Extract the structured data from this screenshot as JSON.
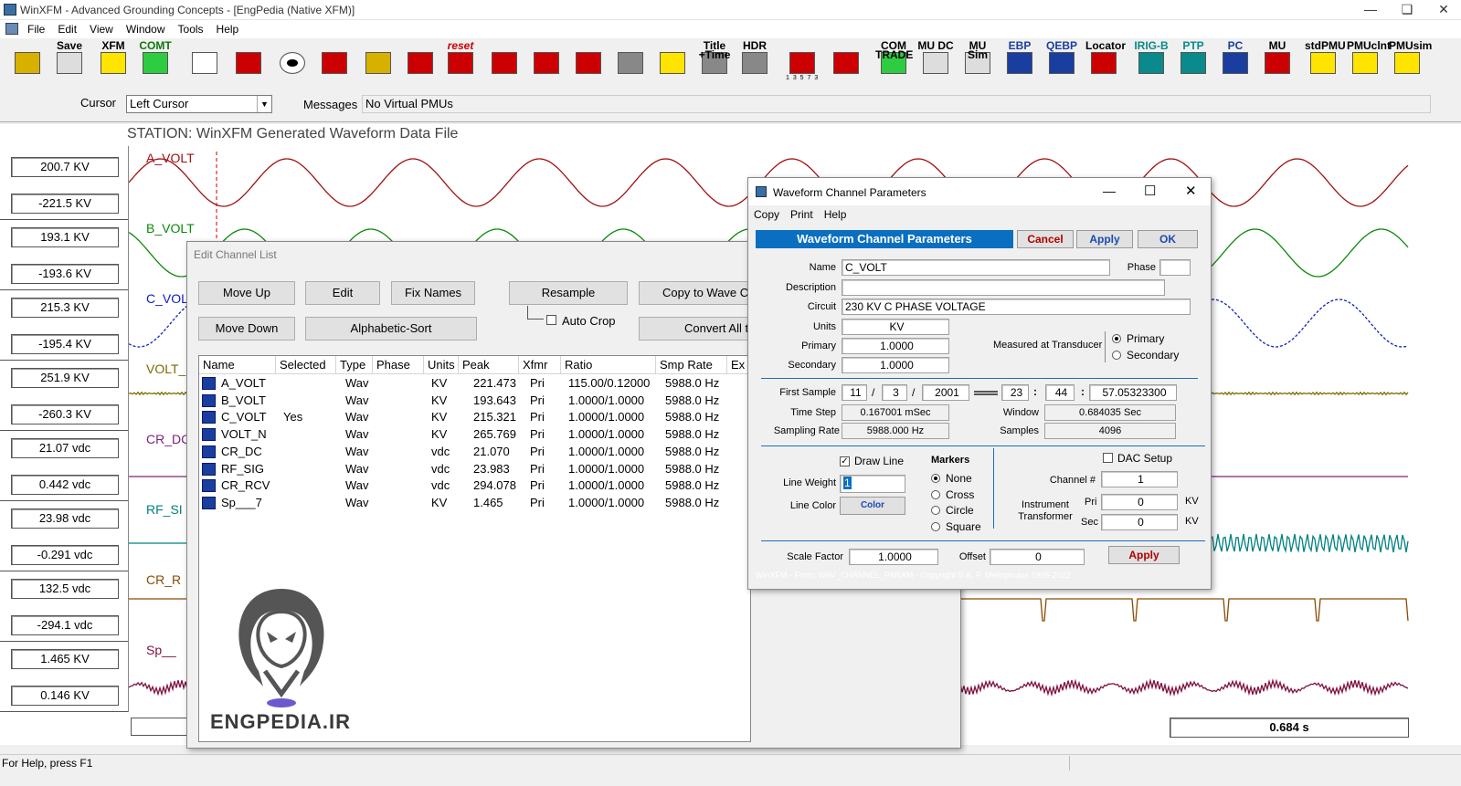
{
  "app": {
    "title": "WinXFM - Advanced Grounding Concepts - [EngPedia (Native XFM)]"
  },
  "menu": [
    "File",
    "Edit",
    "View",
    "Window",
    "Tools",
    "Help"
  ],
  "toolbar": {
    "labels": {
      "save": "Save",
      "xfm": "XFM",
      "comt": "COMT",
      "reset": "reset",
      "title_time": "Title +Time",
      "hdr": "HDR",
      "com_trade": "COM TRADE",
      "mu_dc": "MU DC",
      "mu_sim": "MU Sim",
      "ebp": "EBP",
      "qebp": "QEBP",
      "locator": "Locator",
      "irig_b": "IRIG-B",
      "ptp": "PTP",
      "pc": "PC",
      "mu": "MU",
      "stdpmu": "stdPMU",
      "pmuclnt": "PMUclnt",
      "pmusim": "PMUsim"
    },
    "scale_digits": "1 3 5 7 3"
  },
  "cursorbar": {
    "cursor_label": "Cursor",
    "cursor_value": "Left Cursor",
    "messages_label": "Messages",
    "messages_value": "No Virtual PMUs"
  },
  "plot": {
    "station": "STATION: WinXFM Generated Waveform Data File",
    "channels": [
      {
        "name": "A_VOLT",
        "max": "200.7 KV",
        "min": "-221.5 KV",
        "color": "#a01010"
      },
      {
        "name": "B_VOLT",
        "max": "193.1 KV",
        "min": "-193.6 KV",
        "color": "#0a8a0a"
      },
      {
        "name": "C_VOL",
        "max": "215.3 KV",
        "min": "-195.4 KV",
        "color": "#1020c0"
      },
      {
        "name": "VOLT_",
        "max": "251.9 KV",
        "min": "-260.3 KV",
        "color": "#7a6a00"
      },
      {
        "name": "CR_DC",
        "max": "21.07 vdc",
        "min": "0.442 vdc",
        "color": "#802080"
      },
      {
        "name": "RF_SI",
        "max": "23.98 vdc",
        "min": "-0.291 vdc",
        "color": "#008080"
      },
      {
        "name": "CR_R",
        "max": "132.5 vdc",
        "min": "-294.1 vdc",
        "color": "#8a4a00"
      },
      {
        "name": "Sp__",
        "max": "1.465 KV",
        "min": "0.146 KV",
        "color": "#801040"
      }
    ],
    "time_readout": "0.684 s"
  },
  "status": {
    "text": "For Help, press F1"
  },
  "edit_channel_list": {
    "title": "Edit Channel List",
    "buttons": {
      "move_up": "Move Up",
      "edit": "Edit",
      "fix_names": "Fix Names",
      "resample": "Resample",
      "copy_to_wave": "Copy to Wave C",
      "move_down": "Move Down",
      "alpha_sort": "Alphabetic-Sort",
      "convert_all": "Convert All t"
    },
    "auto_crop": "Auto Crop",
    "columns": [
      "Name",
      "Selected",
      "Type",
      "Phase",
      "Units",
      "Peak",
      "Xfmr",
      "Ratio",
      "Smp Rate",
      "Ex"
    ],
    "rows": [
      {
        "name": "A_VOLT",
        "selected": "",
        "type": "Wav",
        "phase": "",
        "units": "KV",
        "peak": "221.473",
        "xfmr": "Pri",
        "ratio": "115.00/0.12000",
        "rate": "5988.0 Hz"
      },
      {
        "name": "B_VOLT",
        "selected": "",
        "type": "Wav",
        "phase": "",
        "units": "KV",
        "peak": "193.643",
        "xfmr": "Pri",
        "ratio": "1.0000/1.0000",
        "rate": "5988.0 Hz"
      },
      {
        "name": "C_VOLT",
        "selected": "Yes",
        "type": "Wav",
        "phase": "",
        "units": "KV",
        "peak": "215.321",
        "xfmr": "Pri",
        "ratio": "1.0000/1.0000",
        "rate": "5988.0 Hz"
      },
      {
        "name": "VOLT_N",
        "selected": "",
        "type": "Wav",
        "phase": "",
        "units": "KV",
        "peak": "265.769",
        "xfmr": "Pri",
        "ratio": "1.0000/1.0000",
        "rate": "5988.0 Hz"
      },
      {
        "name": "CR_DC",
        "selected": "",
        "type": "Wav",
        "phase": "",
        "units": "vdc",
        "peak": "21.070",
        "xfmr": "Pri",
        "ratio": "1.0000/1.0000",
        "rate": "5988.0 Hz"
      },
      {
        "name": "RF_SIG",
        "selected": "",
        "type": "Wav",
        "phase": "",
        "units": "vdc",
        "peak": "23.983",
        "xfmr": "Pri",
        "ratio": "1.0000/1.0000",
        "rate": "5988.0 Hz"
      },
      {
        "name": "CR_RCV",
        "selected": "",
        "type": "Wav",
        "phase": "",
        "units": "vdc",
        "peak": "294.078",
        "xfmr": "Pri",
        "ratio": "1.0000/1.0000",
        "rate": "5988.0 Hz"
      },
      {
        "name": "Sp___7",
        "selected": "",
        "type": "Wav",
        "phase": "",
        "units": "KV",
        "peak": "1.465",
        "xfmr": "Pri",
        "ratio": "1.0000/1.0000",
        "rate": "5988.0 Hz"
      }
    ],
    "watermark": "ENGPEDIA.IR"
  },
  "wcp": {
    "title": "Waveform Channel Parameters",
    "menu": [
      "Copy",
      "Print",
      "Help"
    ],
    "header": "Waveform Channel Parameters",
    "cancel": "Cancel",
    "apply": "Apply",
    "ok": "OK",
    "name_label": "Name",
    "name": "C_VOLT",
    "phase_label": "Phase",
    "phase": "",
    "description_label": "Description",
    "description": "",
    "circuit_label": "Circuit",
    "circuit": "230 KV C PHASE VOLTAGE",
    "units_label": "Units",
    "units": "KV",
    "primary_label": "Primary",
    "primary": "1.0000",
    "secondary_label": "Secondary",
    "secondary": "1.0000",
    "measured_label": "Measured at Transducer",
    "opt_primary": "Primary",
    "opt_secondary": "Secondary",
    "first_sample_label": "First Sample",
    "fs_month": "11",
    "fs_day": "3",
    "fs_year": "2001",
    "fs_hour": "23",
    "fs_min": "44",
    "fs_sec": "57.05323300",
    "slash": "/",
    "colon": ":",
    "time_step_label": "Time Step",
    "time_step": "0.167001 mSec",
    "window_label": "Window",
    "window": "0.684035 Sec",
    "sampling_rate_label": "Sampling Rate",
    "sampling_rate": "5988.000 Hz",
    "samples_label": "Samples",
    "samples": "4096",
    "draw_line": "Draw Line",
    "line_weight_label": "Line Weight",
    "line_weight": "1",
    "line_color_label": "Line Color",
    "color_btn": "Color",
    "markers_label": "Markers",
    "markers": [
      "None",
      "Cross",
      "Circle",
      "Square"
    ],
    "dac_setup": "DAC Setup",
    "channel_label": "Channel #",
    "channel": "1",
    "inst_label": "Instrument Transformer",
    "pri_label": "Pri",
    "pri": "0",
    "sec_label": "Sec",
    "sec": "0",
    "kv": "KV",
    "scale_label": "Scale Factor",
    "scale": "1.0000",
    "offset_label": "Offset",
    "offset": "0",
    "apply2": "Apply",
    "footer": "WinXFM - Form: WAV_CHANNEL_PARAM - Copyright © A. P. Meliopoulos 1998-2022"
  }
}
